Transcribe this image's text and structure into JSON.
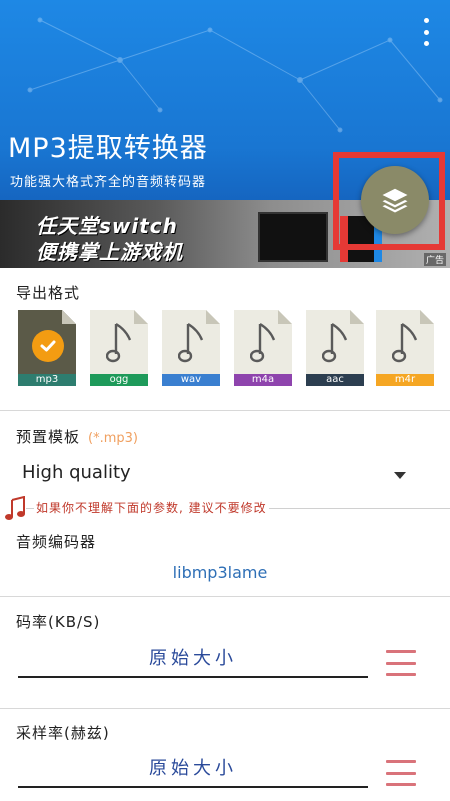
{
  "header": {
    "title": "MP3提取转换器",
    "subtitle": "功能强大格式齐全的音频转码器"
  },
  "ad": {
    "line1": "任天堂switch",
    "line2": "便携掌上游戏机",
    "tag": "广告"
  },
  "export": {
    "label": "导出格式",
    "formats": [
      {
        "name": "mp3",
        "color": "#2e7d6f",
        "selected": true
      },
      {
        "name": "ogg",
        "color": "#1e9a5a",
        "selected": false
      },
      {
        "name": "wav",
        "color": "#3a7fd0",
        "selected": false
      },
      {
        "name": "m4a",
        "color": "#8e44ad",
        "selected": false
      },
      {
        "name": "aac",
        "color": "#2c3e50",
        "selected": false
      },
      {
        "name": "m4r",
        "color": "#f5a623",
        "selected": false
      }
    ]
  },
  "preset": {
    "label": "预置模板",
    "hint": "(*.mp3)",
    "value": "High quality"
  },
  "warning": "如果你不理解下面的参数, 建议不要修改",
  "encoder": {
    "label": "音频编码器",
    "value": "libmp3lame"
  },
  "bitrate": {
    "label": "码率(KB/S)",
    "value": "原始大小"
  },
  "samplerate": {
    "label": "采样率(赫兹)",
    "value": "原始大小"
  },
  "colors": {
    "accent": "#1976d2",
    "highlight": "#e53935",
    "check": "#f39c12",
    "menu_lines": "#d9737a"
  }
}
